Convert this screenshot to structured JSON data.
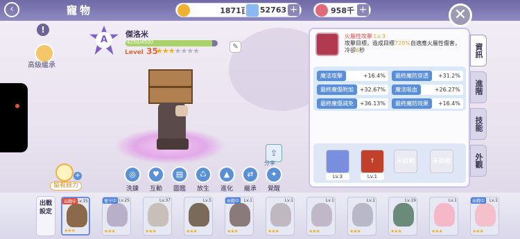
{
  "header": {
    "title": "寵物",
    "resources": [
      {
        "name": "zeny",
        "value": "1871百萬",
        "color": "#f0b030"
      },
      {
        "name": "diamond",
        "value": "52763",
        "color": "#8ab8f0"
      },
      {
        "name": "ticket",
        "value": "958千",
        "color": "#e06a7a"
      }
    ],
    "close_icon": "close-icon"
  },
  "left": {
    "info_label": "!",
    "inherit_label": "高級繼承"
  },
  "pet": {
    "grade": "A",
    "name": "傑洛米",
    "exp_text": "4250/4500",
    "exp_fraction": 0.94,
    "level_prefix": "Level",
    "level": "35",
    "stars": "★★★☆☆☆☆",
    "skill_levels": [
      "Lv.3",
      "Lv.1"
    ]
  },
  "actions": [
    {
      "label": "洗鍊",
      "icon": "wash-icon"
    },
    {
      "label": "互動",
      "icon": "heart-icon"
    },
    {
      "label": "圖鑑",
      "icon": "book-icon"
    },
    {
      "label": "放生",
      "icon": "release-icon"
    },
    {
      "label": "進化",
      "icon": "evolve-icon"
    },
    {
      "label": "繼承",
      "icon": "inherit-icon"
    },
    {
      "label": "覺醒",
      "icon": "awaken-icon"
    }
  ],
  "share_label": "分享",
  "food": {
    "label": "留有餘力"
  },
  "panel": {
    "skill": {
      "name": "火屬性攻擊",
      "level": "Lv.3",
      "desc_prefix": "攻擊目標，造成目標",
      "desc_highlight": "720%",
      "desc_suffix": "自適應火屬性傷害，冷卻",
      "desc_cd": "6",
      "desc_unit": "秒"
    },
    "stats": [
      {
        "key": "魔法攻擊",
        "value": "+16.4%"
      },
      {
        "key": "最終魔防穿透",
        "value": "+31.2%"
      },
      {
        "key": "最終魔傷附加",
        "value": "+32.67%"
      },
      {
        "key": "魔法吸血",
        "value": "+26.27%"
      },
      {
        "key": "最終魔傷減免",
        "value": "+36.13%"
      },
      {
        "key": "最終魔防效果",
        "value": "+16.4%"
      }
    ],
    "slots": [
      {
        "label": "",
        "level": "Lv.3",
        "color": "#7a8ee0"
      },
      {
        "label": "",
        "level": "Lv.1",
        "color": "#c0402a"
      },
      {
        "label": "未啟動",
        "level": "",
        "color": "#c8c8d6"
      },
      {
        "label": "未啟動",
        "level": "",
        "color": "#c8c8d6"
      }
    ]
  },
  "tabs": [
    "資訊",
    "進階",
    "技能",
    "外觀"
  ],
  "deploy_label": "出戰設定",
  "roster": [
    {
      "level": "Lv.35",
      "tag": "出戰中",
      "tag_color": "red",
      "stars": "★★★",
      "color": "#8a6a4a",
      "selected": true
    },
    {
      "level": "Lv.25",
      "tag": "留守中",
      "tag_color": "blue",
      "stars": "★★★",
      "color": "#b8b0c8"
    },
    {
      "level": "Lv.37",
      "tag": "",
      "tag_color": "",
      "stars": "★★★",
      "color": "#c8c0b8"
    },
    {
      "level": "Lv.5",
      "tag": "",
      "tag_color": "",
      "stars": "★★★",
      "color": "#7a6a5a"
    },
    {
      "level": "Lv.1",
      "tag": "出戰中",
      "tag_color": "blue",
      "stars": "★★★",
      "color": "#8a7a7a"
    },
    {
      "level": "Lv.1",
      "tag": "",
      "tag_color": "",
      "stars": "★★★",
      "color": "#c0b8c0"
    },
    {
      "level": "Lv.1",
      "tag": "",
      "tag_color": "",
      "stars": "★★★",
      "color": "#c0b8c8"
    },
    {
      "level": "Lv.1",
      "tag": "",
      "tag_color": "",
      "stars": "★★★",
      "color": "#b8b8c8"
    },
    {
      "level": "Lv.19",
      "tag": "",
      "tag_color": "",
      "stars": "★★★",
      "color": "#6a8a7a"
    },
    {
      "level": "Lv.1",
      "tag": "",
      "tag_color": "",
      "stars": "★★★",
      "color": "#f4b8c8"
    },
    {
      "level": "Lv.1",
      "tag": "出戰中",
      "tag_color": "blue",
      "stars": "★★★",
      "color": "#f4c0cc"
    }
  ]
}
